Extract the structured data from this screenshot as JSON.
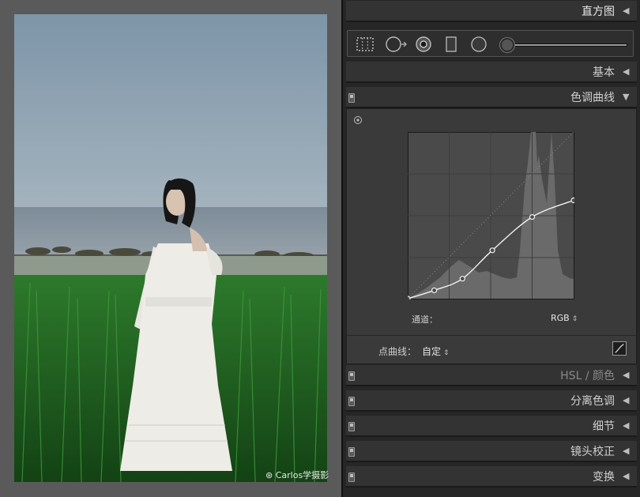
{
  "photo": {
    "watermark": "Carlos学摄影"
  },
  "panels": {
    "histogram": {
      "title": "直方图",
      "arrow": "◀"
    },
    "basic": {
      "title": "基本",
      "arrow": "◀"
    },
    "tone_curve": {
      "title": "色调曲线",
      "arrow": "▼",
      "channel_label": "通道：",
      "channel_value": "RGB",
      "point_curve_label": "点曲线：",
      "point_curve_value": "自定",
      "updown_glyph": "⇕"
    },
    "hsl": {
      "title": "HSL / 颜色",
      "arrow": "◀"
    },
    "split_toning": {
      "title": "分离色调",
      "arrow": "◀"
    },
    "detail": {
      "title": "细节",
      "arrow": "◀"
    },
    "lens_correction": {
      "title": "镜头校正",
      "arrow": "◀"
    },
    "transform": {
      "title": "变换",
      "arrow": "◀"
    }
  },
  "tools": [
    "crop-overlay-icon",
    "spot-removal-icon",
    "red-eye-icon",
    "graduated-filter-icon",
    "radial-filter-icon",
    "adjustment-brush-icon"
  ],
  "curve": {
    "points": [
      [
        0,
        0
      ],
      [
        0.16,
        0.05
      ],
      [
        0.33,
        0.12
      ],
      [
        0.51,
        0.29
      ],
      [
        0.75,
        0.49
      ],
      [
        1.0,
        0.59
      ]
    ]
  },
  "colors": {
    "panel_bg": "#262626",
    "header_bg": "#333333",
    "curve_bg": "#4a4a4a",
    "histogram": "#6a6a6a"
  }
}
